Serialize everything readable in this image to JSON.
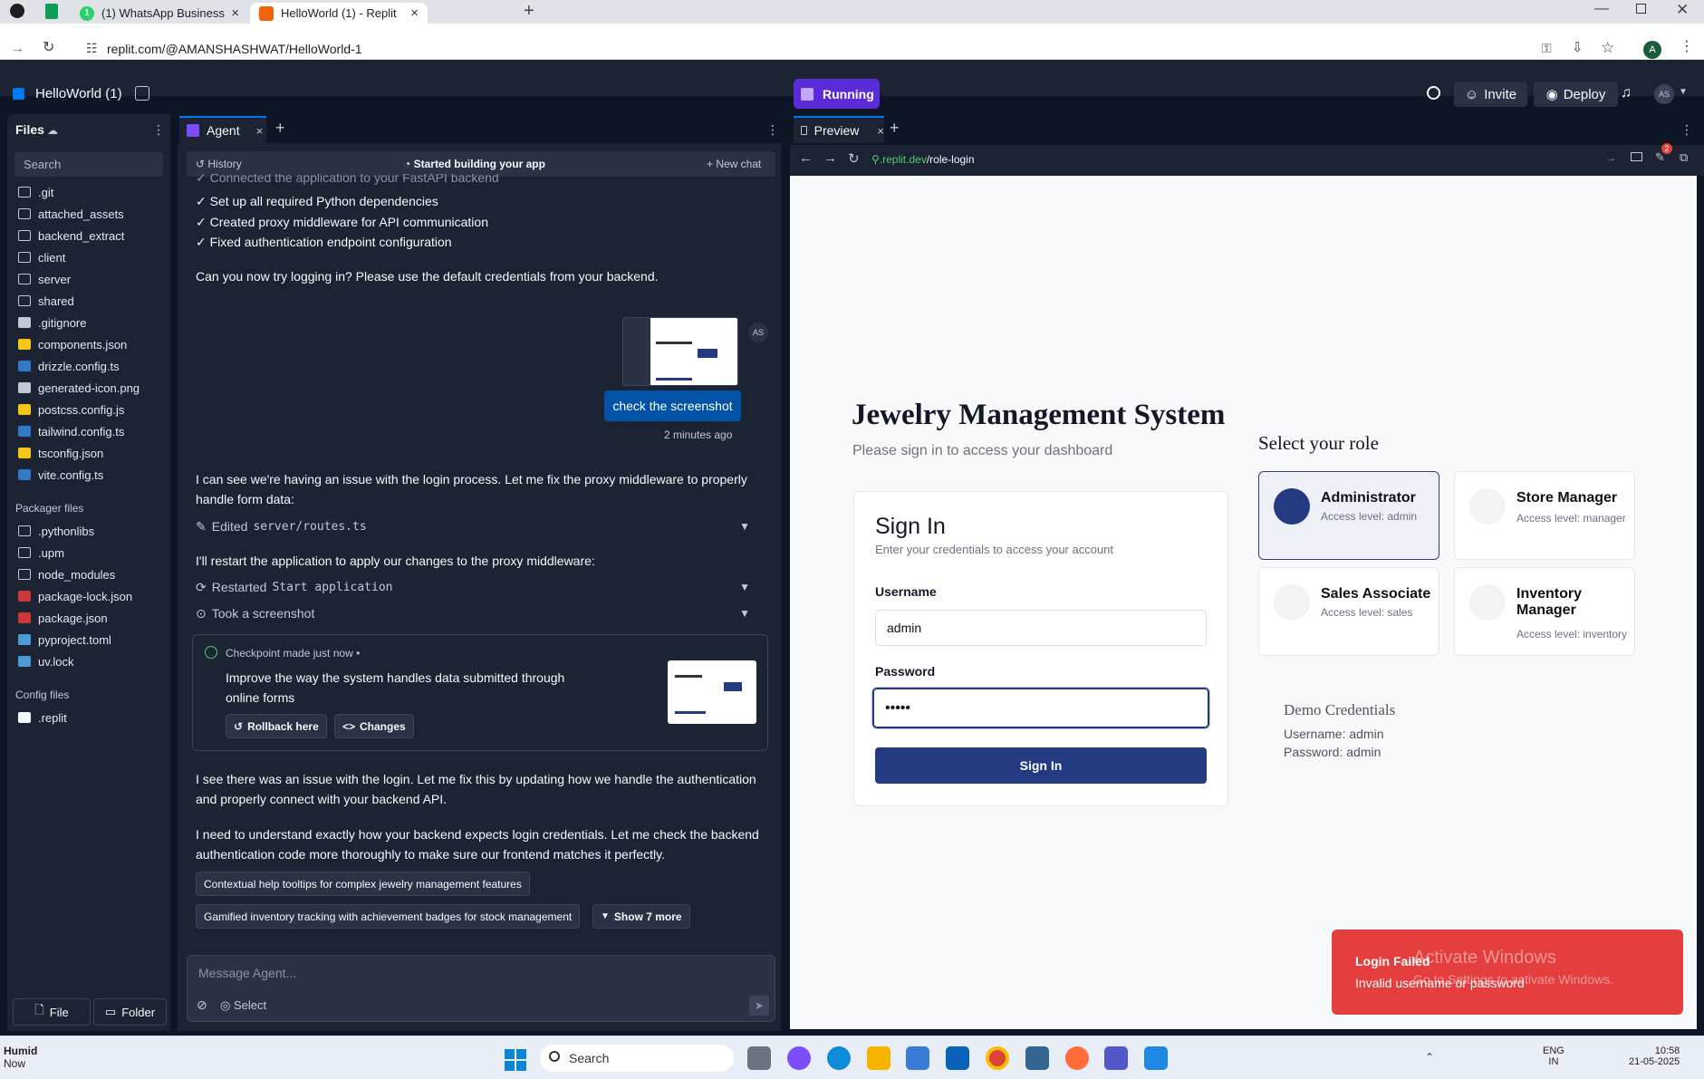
{
  "browser": {
    "tabs": [
      {
        "label": "(1) WhatsApp Business",
        "active": false
      },
      {
        "label": "HelloWorld (1) - Replit",
        "active": true
      }
    ],
    "url": "replit.com/@AMANSHASHWAT/HelloWorld-1",
    "profile_initial": "A"
  },
  "replit": {
    "project_name": "HelloWorld (1)",
    "run_status": "Running",
    "invite_label": "Invite",
    "deploy_label": "Deploy",
    "avatar_initials": "AS"
  },
  "files": {
    "title": "Files",
    "search_placeholder": "Search",
    "items": [
      {
        "name": ".git",
        "type": "folder"
      },
      {
        "name": "attached_assets",
        "type": "folder"
      },
      {
        "name": "backend_extract",
        "type": "folder"
      },
      {
        "name": "client",
        "type": "folder"
      },
      {
        "name": "server",
        "type": "folder"
      },
      {
        "name": "shared",
        "type": "folder"
      },
      {
        "name": ".gitignore",
        "type": "file"
      },
      {
        "name": "components.json",
        "type": "json"
      },
      {
        "name": "drizzle.config.ts",
        "type": "ts"
      },
      {
        "name": "generated-icon.png",
        "type": "image"
      },
      {
        "name": "postcss.config.js",
        "type": "js"
      },
      {
        "name": "tailwind.config.ts",
        "type": "ts"
      },
      {
        "name": "tsconfig.json",
        "type": "json"
      },
      {
        "name": "vite.config.ts",
        "type": "ts"
      }
    ],
    "packager_title": "Packager files",
    "packager_items": [
      {
        "name": ".pythonlibs",
        "type": "folder"
      },
      {
        "name": ".upm",
        "type": "folder"
      },
      {
        "name": "node_modules",
        "type": "folder"
      },
      {
        "name": "package-lock.json",
        "type": "npm"
      },
      {
        "name": "package.json",
        "type": "npm"
      },
      {
        "name": "pyproject.toml",
        "type": "py"
      },
      {
        "name": "uv.lock",
        "type": "py"
      }
    ],
    "config_title": "Config files",
    "config_items": [
      {
        "name": ".replit",
        "type": "replit"
      }
    ],
    "file_button": "File",
    "folder_button": "Folder"
  },
  "agent": {
    "tab_label": "Agent",
    "history_label": "History",
    "status": "Started building your app",
    "new_chat": "New chat",
    "cut_line": "✓ Connected the application to your FastAPI backend",
    "checklist": [
      "✓ Set up all required Python dependencies",
      "✓ Created proxy middleware for API communication",
      "✓ Fixed authentication endpoint configuration"
    ],
    "msg1": "Can you now try logging in? Please use the default credentials from your backend.",
    "user_avatar": "AS",
    "user_message": "check the screenshot",
    "user_time": "2 minutes ago",
    "msg2": "I can see we're having an issue with the login process. Let me fix the proxy middleware to properly handle form data:",
    "tool1_prefix": "Edited",
    "tool1_code": "server/routes.ts",
    "msg3": "I'll restart the application to apply our changes to the proxy middleware:",
    "tool2_prefix": "Restarted",
    "tool2_code": "Start application",
    "tool3": "Took a screenshot",
    "checkpoint_header": "Checkpoint made just now •",
    "checkpoint_text": "Improve the way the system handles data submitted through online forms",
    "rollback_label": "Rollback here",
    "changes_label": "Changes",
    "msg4": "I see there was an issue with the login. Let me fix this by updating how we handle the authentication and properly connect with your backend API.",
    "msg5": "I need to understand exactly how your backend expects login credentials. Let me check the backend authentication code more thoroughly to make sure our frontend matches it perfectly.",
    "suggestion1": "Contextual help tooltips for complex jewelry management features",
    "suggestion2": "Gamified inventory tracking with achievement badges for stock management",
    "show_more": "Show 7 more",
    "input_placeholder": "Message Agent...",
    "select_label": "Select"
  },
  "preview": {
    "tab_label": "Preview",
    "url_domain": ".replit.dev",
    "url_path": "/role-login",
    "badge_count": "2",
    "app": {
      "title": "Jewelry Management System",
      "subtitle": "Please sign in to access your dashboard",
      "signin_title": "Sign In",
      "signin_subtitle": "Enter your credentials to access your account",
      "username_label": "Username",
      "username_value": "admin",
      "password_label": "Password",
      "password_value": "•••••",
      "signin_button": "Sign In",
      "roles_title": "Select your role",
      "roles": [
        {
          "title": "Administrator",
          "sub": "Access level: admin",
          "selected": true
        },
        {
          "title": "Store Manager",
          "sub": "Access level: manager",
          "selected": false
        },
        {
          "title": "Sales Associate",
          "sub": "Access level: sales",
          "selected": false
        },
        {
          "title": "Inventory Manager",
          "sub": "Access level: inventory",
          "selected": false
        }
      ],
      "demo_title": "Demo Credentials",
      "demo_username": "Username: admin",
      "demo_password": "Password: admin"
    },
    "toast": {
      "title": "Login Failed",
      "message": "Invalid username or password",
      "color": "#e53e3e"
    },
    "watermark_title": "Activate Windows",
    "watermark_sub": "Go to Settings to activate Windows."
  },
  "taskbar": {
    "weather_title": "Humid",
    "weather_sub": "Now",
    "search": "Search",
    "lang1": "ENG",
    "lang2": "IN",
    "time": "10:58",
    "date": "21-05-2025"
  },
  "colors": {
    "replit_bg": "#1c2333",
    "accent_blue": "#0079f2",
    "running_purple": "#5b2bd8",
    "signin_navy": "#233a82",
    "toast_red": "#e53e3e"
  }
}
